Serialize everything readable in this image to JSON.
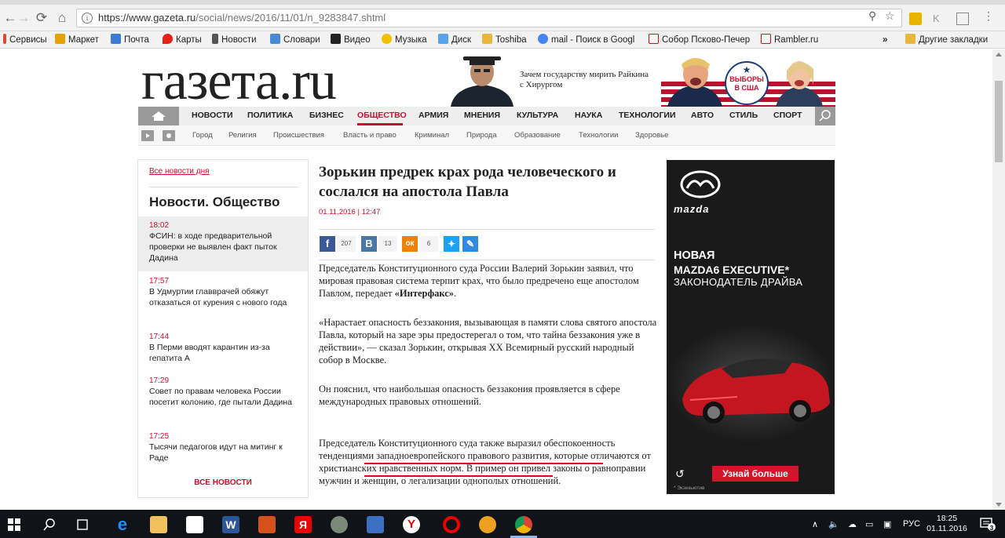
{
  "browser": {
    "url_host": "https://www.gazeta.ru",
    "url_path": "/social/news/2016/11/01/n_9283847.shtml",
    "bookmarks": [
      "Сервисы",
      "Маркет",
      "Почта",
      "Карты",
      "Новости",
      "Словари",
      "Видео",
      "Музыка",
      "Диск",
      "Toshiba",
      "mail - Поиск в Googl",
      "Собор Псково-Печер",
      "Rambler.ru"
    ],
    "overflow": "»",
    "other_bookmarks": "Другие закладки"
  },
  "site": {
    "logo": "газета.ru",
    "promo": "Зачем государству мирить Райкина с Хирургом",
    "election_badge_line1": "ВЫБОРЫ",
    "election_badge_line2": "В США",
    "menu": [
      "НОВОСТИ",
      "ПОЛИТИКА",
      "БИЗНЕС",
      "ОБЩЕСТВО",
      "АРМИЯ",
      "МНЕНИЯ",
      "КУЛЬТУРА",
      "НАУКА",
      "ТЕХНОЛОГИИ",
      "АВТО",
      "СТИЛЬ",
      "СПОРТ"
    ],
    "submenu": [
      "Город",
      "Религия",
      "Происшествия",
      "Власть и право",
      "Криминал",
      "Природа",
      "Образование",
      "Технологии",
      "Здоровье"
    ]
  },
  "sidebar": {
    "all_day": "Все новости дня",
    "title": "Новости. Общество",
    "items": [
      {
        "time": "18:02",
        "text": "ФСИН: в ходе предварительной проверки не выявлен факт пыток Дадина"
      },
      {
        "time": "17:57",
        "text": "В Удмуртии главврачей обяжут отказаться от курения с нового года"
      },
      {
        "time": "17:44",
        "text": "В Перми вводят карантин из-за гепатита А"
      },
      {
        "time": "17:29",
        "text": "Совет по правам человека России посетит колонию, где пытали Дадина"
      },
      {
        "time": "17:25",
        "text": "Тысячи педагогов идут на митинг к Раде"
      }
    ],
    "all_news": "ВСЕ НОВОСТИ"
  },
  "article": {
    "headline": "Зорькин предрек крах рода человеческого и сослался на апостола Павла",
    "date": "01.11.2016 | 12:47",
    "share": [
      {
        "label": "f",
        "count": "207",
        "color": "#3b5998"
      },
      {
        "label": "В",
        "count": "13",
        "color": "#4a76a8"
      },
      {
        "label": "ок",
        "count": "6",
        "color": "#ee8208"
      }
    ],
    "p1_a": "Председатель Конституционного суда России Валерий Зорькин заявил, что мировая правовая система терпит крах, что было предречено еще апостолом Павлом, передает ",
    "p1_b": "«Интерфакс»",
    "p1_c": ".",
    "p2": "«Нарастает опасность беззакония, вызывающая в памяти слова святого апостола Павла, который на заре эры предостерегал о том, что тайна беззакония уже в действии», — сказал Зорькин, открывая XX Всемирный русский народный собор в Москве.",
    "p3": "Он пояснил, что наибольшая опасность беззакония проявляется в сфере международных правовых отношений.",
    "p4": "Председатель Конституционного суда также выразил обеспокоенность тенденциями западноевропейского правового развития, которые отличаются от христианских нравственных норм. В пример он привел законы о равноправии мужчин и женщин, о легализации однополых отношений."
  },
  "ad": {
    "brand": "mazda",
    "line1": "НОВАЯ",
    "line2": "MAZDA6 EXECUTIVE*",
    "line3": "ЗАКОНОДАТЕЛЬ ДРАЙВА",
    "cta": "Узнай больше",
    "legal": "* Экзекьютив"
  },
  "taskbar": {
    "lang": "РУС",
    "time": "18:25",
    "date": "01.11.2016",
    "notif_count": "3"
  }
}
